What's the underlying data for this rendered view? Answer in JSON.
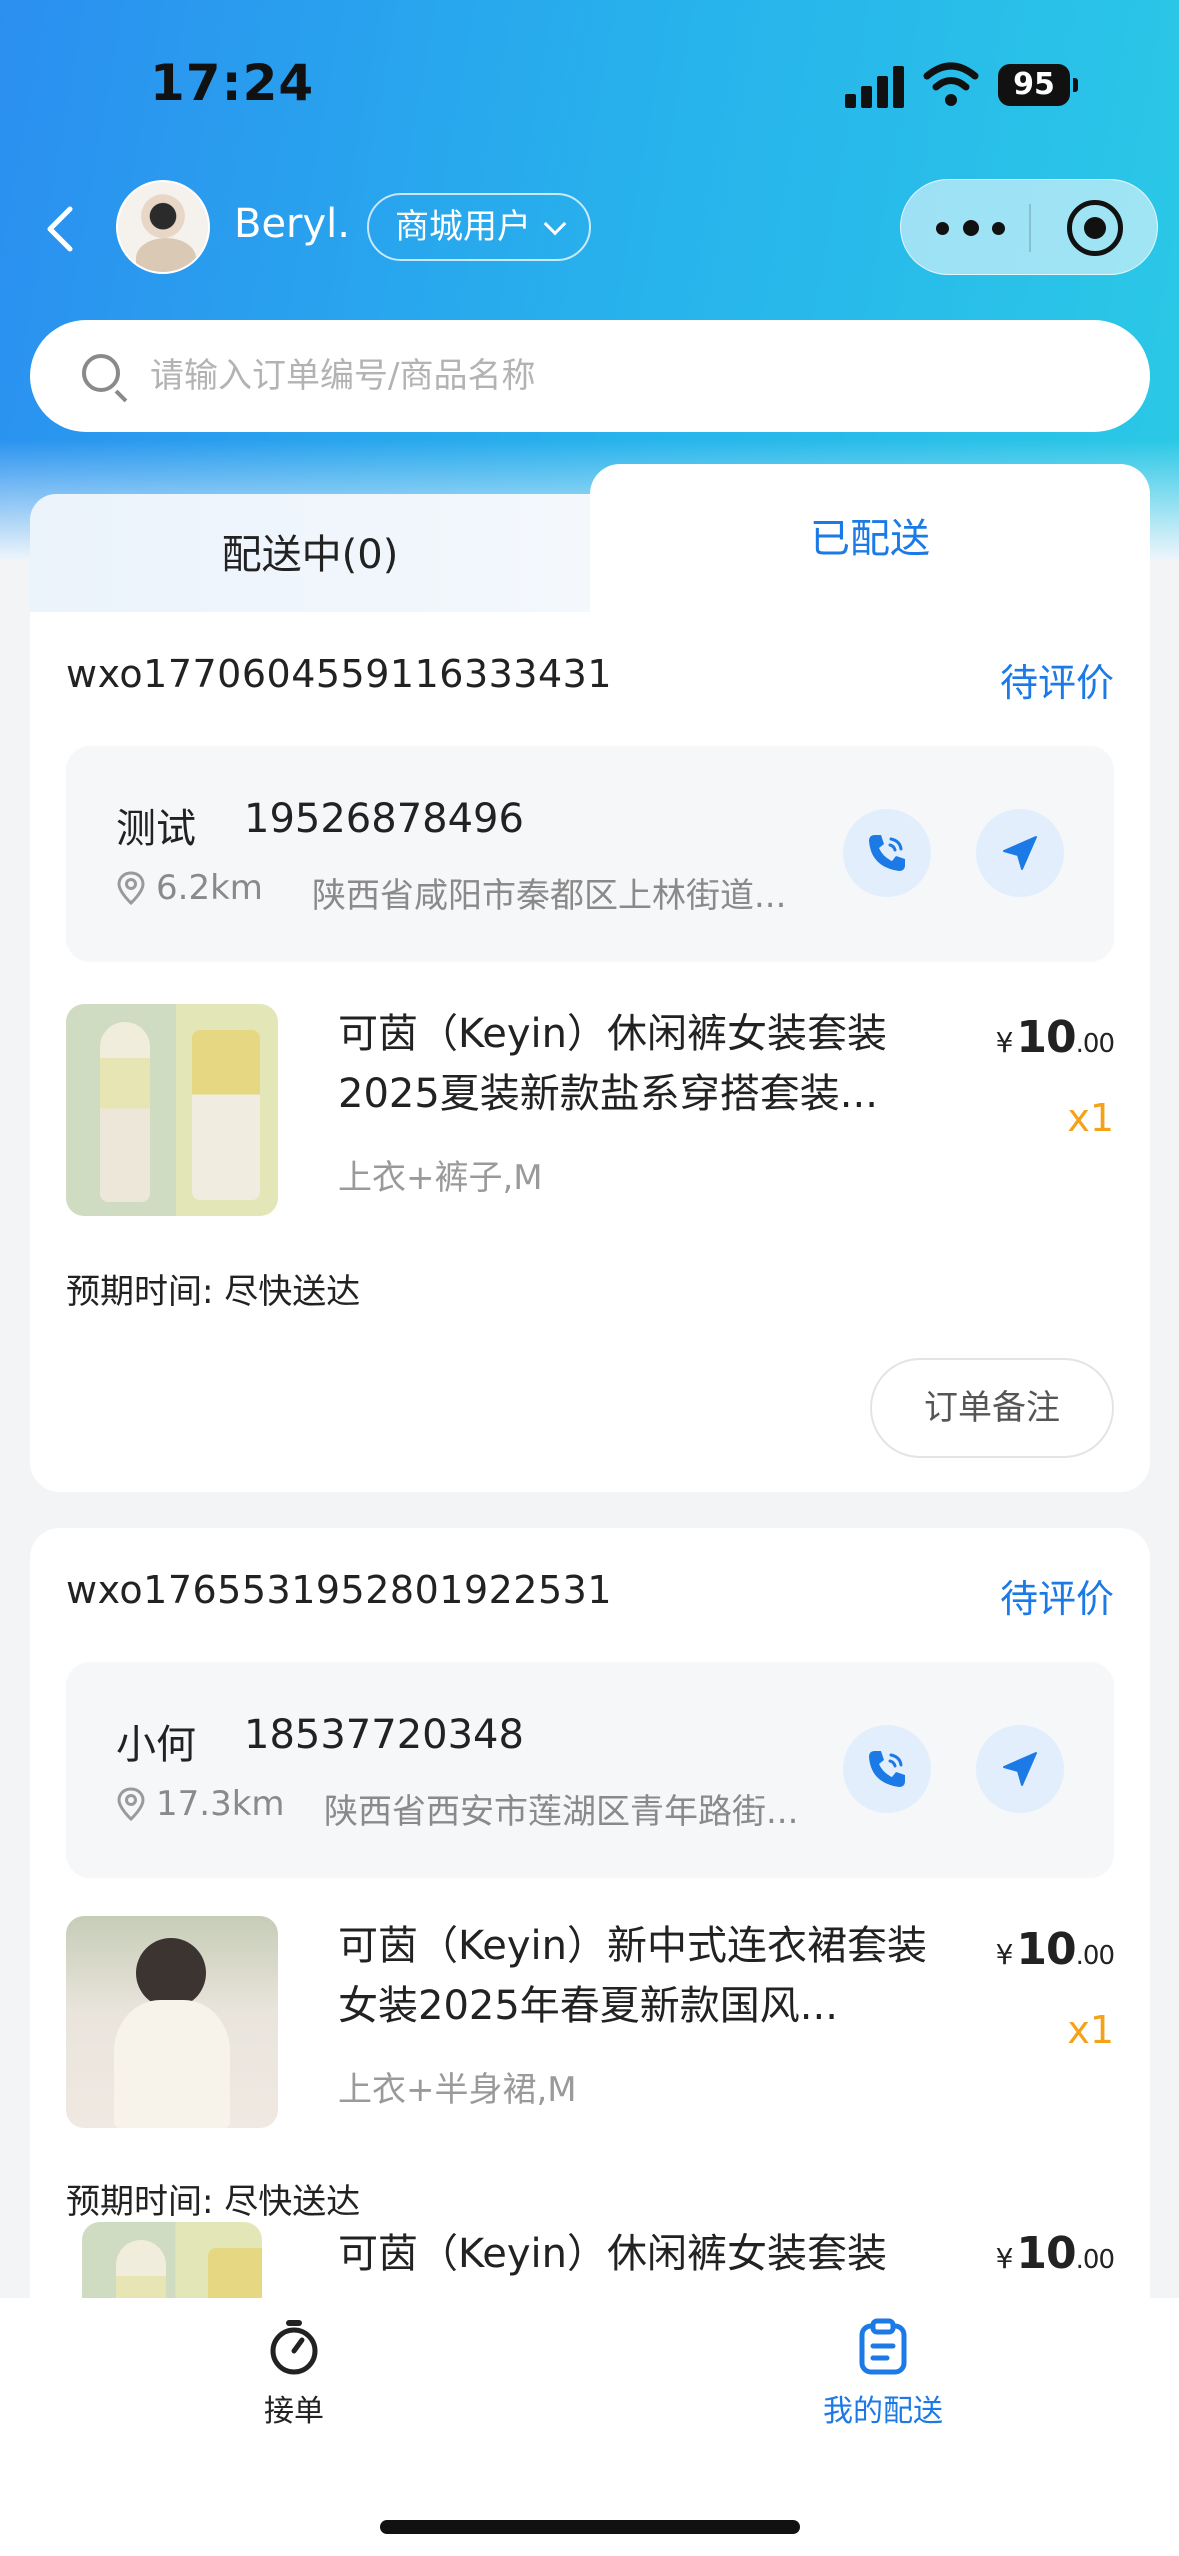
{
  "status_bar": {
    "time": "17:24",
    "battery": "95"
  },
  "header": {
    "back_icon": "chevron-left-icon",
    "user_name": "Beryl.",
    "role_label": "商城用户",
    "more_icon": "more-dots-icon",
    "close_icon": "record-circle-icon"
  },
  "search": {
    "placeholder": "请输入订单编号/商品名称"
  },
  "tabs": [
    {
      "label": "配送中(0)",
      "active": false
    },
    {
      "label": "已配送",
      "active": true
    }
  ],
  "orders": [
    {
      "order_no": "wxo17706045591163334 31",
      "status": "待评价",
      "receiver_name": "测试",
      "receiver_phone": "19526878496",
      "distance": "6.2km",
      "address": "陕西省咸阳市秦都区上林街道...",
      "items": [
        {
          "title": "可茵（Keyin）休闲裤女装套装2025夏装新款盐系穿搭套装...",
          "spec": "上衣+裤子,M",
          "price_currency": "¥",
          "price_int": "10",
          "price_dec": ".00",
          "qty": "x1"
        }
      ],
      "eta": "预期时间: 尽快送达",
      "remark_button": "订单备注"
    },
    {
      "order_no": "wxo176553195280192253 1",
      "status": "待评价",
      "receiver_name": "小何",
      "receiver_phone": "18537720348",
      "distance": "17.3km",
      "address": "陕西省西安市莲湖区青年路街...",
      "items": [
        {
          "title": "可茵（Keyin）新中式连衣裙套装女装2025年春夏新款国风...",
          "spec": "上衣+半身裙,M",
          "price_currency": "¥",
          "price_int": "10",
          "price_dec": ".00",
          "qty": "x1"
        },
        {
          "title": "可茵（Keyin）休闲裤女装套装",
          "price_currency": "¥",
          "price_int": "10",
          "price_dec": ".00"
        }
      ],
      "eta": "预期时间: 尽快送达"
    }
  ],
  "bottom_tabs": [
    {
      "label": "接单",
      "icon": "stopwatch-icon",
      "active": false
    },
    {
      "label": "我的配送",
      "icon": "clipboard-icon",
      "active": true
    }
  ],
  "colors": {
    "accent": "#1c7ae6",
    "qty": "#f5a21b",
    "header_start": "#2b8ff0",
    "header_end": "#2bc9e6"
  }
}
